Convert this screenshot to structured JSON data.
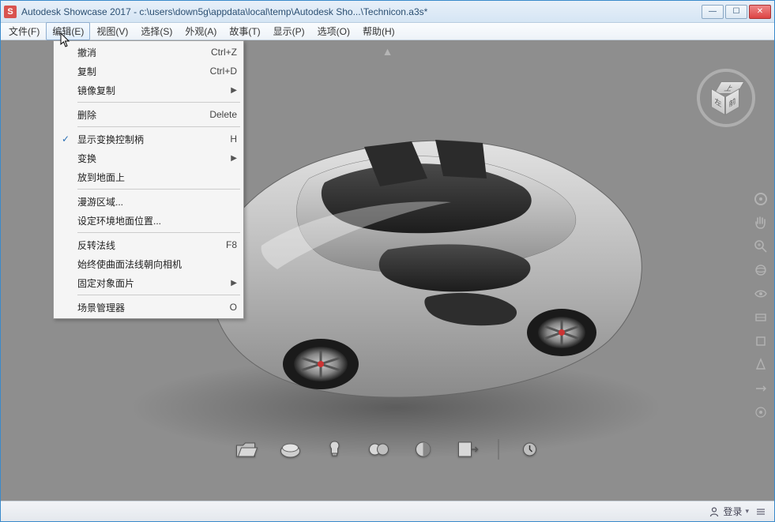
{
  "window": {
    "app_icon_letter": "S",
    "title": "Autodesk Showcase 2017 - c:\\users\\down5g\\appdata\\local\\temp\\Autodesk Sho...\\Technicon.a3s*"
  },
  "menubar": {
    "items": [
      {
        "label": "文件(F)"
      },
      {
        "label": "编辑(E)"
      },
      {
        "label": "视图(V)"
      },
      {
        "label": "选择(S)"
      },
      {
        "label": "外观(A)"
      },
      {
        "label": "故事(T)"
      },
      {
        "label": "显示(P)"
      },
      {
        "label": "选项(O)"
      },
      {
        "label": "帮助(H)"
      }
    ],
    "active_index": 1
  },
  "dropdown": {
    "groups": [
      [
        {
          "label": "撤消",
          "accel": "Ctrl+Z"
        },
        {
          "label": "复制",
          "accel": "Ctrl+D"
        },
        {
          "label": "镜像复制",
          "submenu": true
        }
      ],
      [
        {
          "label": "删除",
          "accel": "Delete"
        }
      ],
      [
        {
          "label": "显示变换控制柄",
          "accel": "H",
          "checked": true
        },
        {
          "label": "变换",
          "submenu": true
        },
        {
          "label": "放到地面上"
        }
      ],
      [
        {
          "label": "漫游区域..."
        },
        {
          "label": "设定环境地面位置..."
        }
      ],
      [
        {
          "label": "反转法线",
          "accel": "F8"
        },
        {
          "label": "始终使曲面法线朝向相机"
        },
        {
          "label": "固定对象面片",
          "submenu": true
        }
      ],
      [
        {
          "label": "场景管理器",
          "accel": "O"
        }
      ]
    ]
  },
  "viewcube": {
    "top": "上",
    "left": "左",
    "right": "前"
  },
  "statusbar": {
    "login": "登录"
  },
  "icons": {
    "minimize": "—",
    "maximize": "☐",
    "close": "✕",
    "up_arrow": "▲",
    "submenu_arrow": "▶",
    "check": "✓",
    "caret": "▾"
  }
}
